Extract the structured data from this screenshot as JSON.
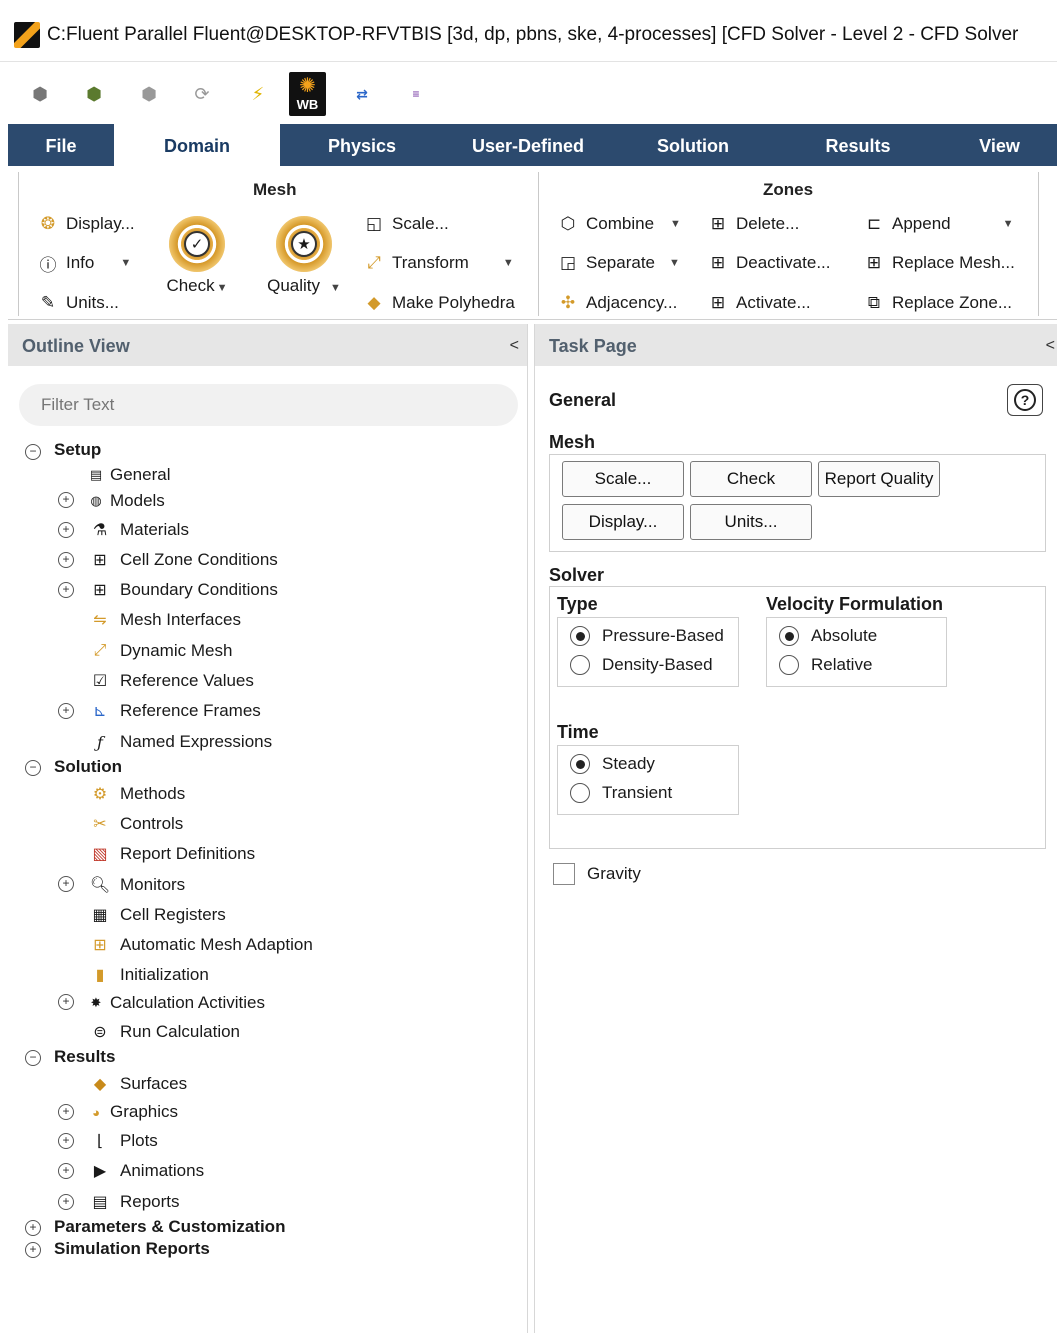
{
  "window": {
    "title": "C:Fluent Parallel Fluent@DESKTOP-RFVTBIS  [3d, dp, pbns, ske, 4-processes] [CFD Solver - Level 2 - CFD Solver"
  },
  "menu": {
    "tabs": [
      "File",
      "Domain",
      "Physics",
      "User-Defined",
      "Solution",
      "Results",
      "View"
    ],
    "active": "Domain"
  },
  "ribbon": {
    "mesh": {
      "title": "Mesh",
      "display": "Display...",
      "info": "Info",
      "units": "Units...",
      "check": "Check",
      "quality": "Quality",
      "scale": "Scale...",
      "transform": "Transform",
      "polyhedra": "Make Polyhedra"
    },
    "zones": {
      "title": "Zones",
      "combine": "Combine",
      "separate": "Separate",
      "adjacency": "Adjacency...",
      "delete": "Delete...",
      "deactivate": "Deactivate...",
      "activate": "Activate...",
      "append": "Append",
      "replace_mesh": "Replace Mesh...",
      "replace_zone": "Replace Zone..."
    }
  },
  "outline": {
    "title": "Outline View",
    "filter_placeholder": "Filter Text",
    "setup": "Setup",
    "setup_items": [
      "General",
      "Models",
      "Materials",
      "Cell Zone Conditions",
      "Boundary Conditions",
      "Mesh Interfaces",
      "Dynamic Mesh",
      "Reference Values",
      "Reference Frames",
      "Named Expressions"
    ],
    "solution": "Solution",
    "solution_items": [
      "Methods",
      "Controls",
      "Report Definitions",
      "Monitors",
      "Cell Registers",
      "Automatic Mesh Adaption",
      "Initialization",
      "Calculation Activities",
      "Run Calculation"
    ],
    "results": "Results",
    "results_items": [
      "Surfaces",
      "Graphics",
      "Plots",
      "Animations",
      "Reports"
    ],
    "parameters": "Parameters & Customization",
    "sim_reports": "Simulation Reports"
  },
  "task": {
    "title": "Task Page",
    "heading": "General",
    "mesh_label": "Mesh",
    "mesh_buttons": {
      "scale": "Scale...",
      "check": "Check",
      "report_quality": "Report Quality",
      "display": "Display...",
      "units": "Units..."
    },
    "solver_label": "Solver",
    "type_label": "Type",
    "type_options": [
      "Pressure-Based",
      "Density-Based"
    ],
    "type_selected": "Pressure-Based",
    "velocity_label": "Velocity Formulation",
    "velocity_options": [
      "Absolute",
      "Relative"
    ],
    "velocity_selected": "Absolute",
    "time_label": "Time",
    "time_options": [
      "Steady",
      "Transient"
    ],
    "time_selected": "Steady",
    "gravity": "Gravity",
    "gravity_checked": false
  }
}
